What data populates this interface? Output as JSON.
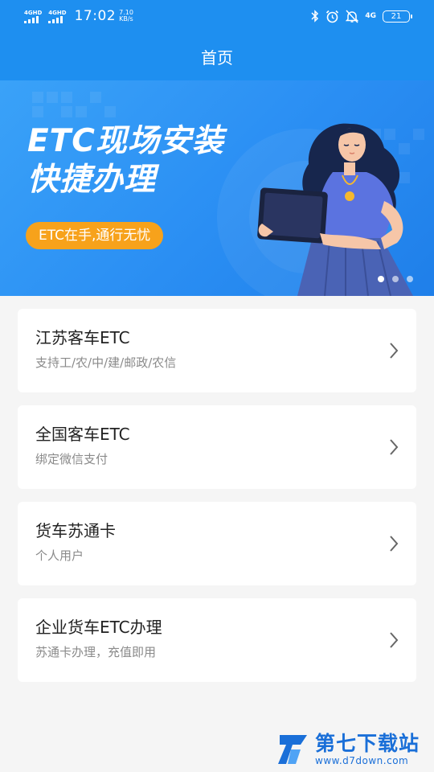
{
  "status_bar": {
    "network_1": "4G",
    "network_1_sup": "HD",
    "network_2": "4G",
    "network_2_sup": "HD",
    "time": "17:02",
    "speed_value": "7.10",
    "speed_unit": "KB/s",
    "data_icon_label": "4G",
    "battery": "21",
    "icons": [
      "bluetooth-icon",
      "alarm-icon",
      "mute-icon",
      "4g-data-icon",
      "battery-icon"
    ]
  },
  "header": {
    "title": "首页"
  },
  "banner": {
    "title_line1": "ETC现场安装",
    "title_line2": "快捷办理",
    "pill": "ETC在手,通行无忧",
    "page_count": 3,
    "active_index": 0
  },
  "cards": [
    {
      "title": "江苏客车ETC",
      "subtitle": "支持工/农/中/建/邮政/农信"
    },
    {
      "title": "全国客车ETC",
      "subtitle": "绑定微信支付"
    },
    {
      "title": "货车苏通卡",
      "subtitle": "个人用户"
    },
    {
      "title": "企业货车ETC办理",
      "subtitle": "苏通卡办理，充值即用"
    }
  ],
  "watermark": {
    "brand": "第七下载站",
    "url": "www.d7down.com"
  },
  "colors": {
    "primary": "#1e8ff0",
    "pill": "#f7a21b",
    "background": "#f5f5f5",
    "card": "#ffffff"
  }
}
